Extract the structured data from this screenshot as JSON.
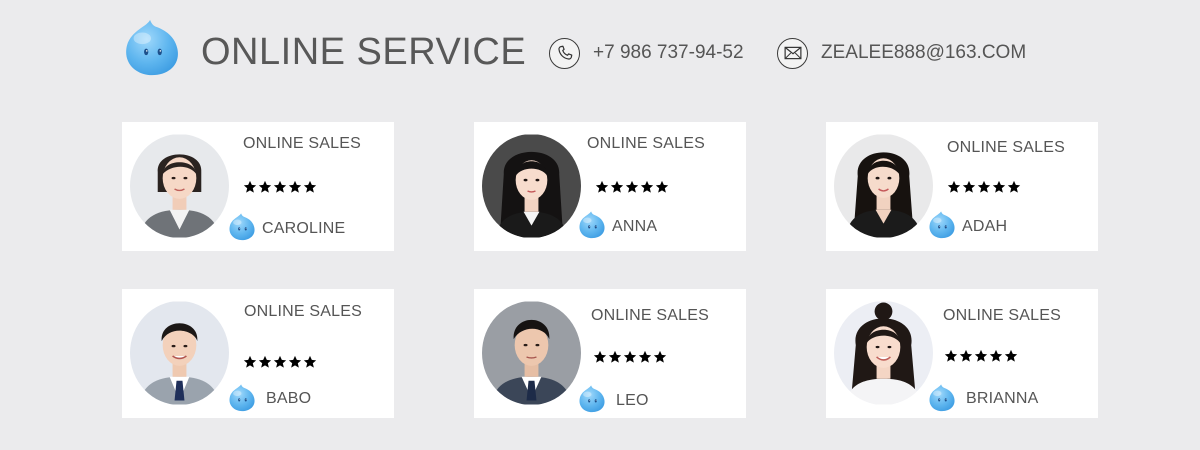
{
  "header": {
    "title": "ONLINE SERVICE",
    "mascot_icon": "qq-penguin-icon",
    "phone": {
      "icon": "phone-icon",
      "text": "+7 986 737-94-52"
    },
    "email": {
      "icon": "envelope-icon",
      "text": "ZEALEE888@163.COM"
    }
  },
  "agents": [
    {
      "role": "ONLINE SALES",
      "rating": 5,
      "name": "CAROLINE"
    },
    {
      "role": "ONLINE SALES",
      "rating": 5,
      "name": "ANNA"
    },
    {
      "role": "ONLINE SALES",
      "rating": 5,
      "name": "ADAH"
    },
    {
      "role": "ONLINE SALES",
      "rating": 5,
      "name": "BABO"
    },
    {
      "role": "ONLINE SALES",
      "rating": 5,
      "name": "LEO"
    },
    {
      "role": "ONLINE SALES",
      "rating": 5,
      "name": "BRIANNA"
    }
  ],
  "colors": {
    "background": "#ebebed",
    "card": "#ffffff",
    "text": "#555555",
    "mascot_blue": "#5fb6ef",
    "star": "#000000"
  }
}
